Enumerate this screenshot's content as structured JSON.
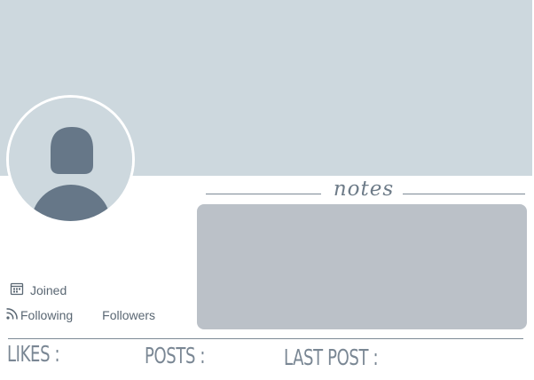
{
  "profile": {
    "joined_label": "Joined",
    "following_label": "Following",
    "followers_label": "Followers"
  },
  "notes": {
    "heading": "notes"
  },
  "footer": {
    "likes_label": "LIKES :",
    "posts_label": "POSTS :",
    "last_post_label": "LAST POST :"
  },
  "icons": {
    "avatar": "user-silhouette-icon",
    "joined": "calendar-icon",
    "following": "rss-icon"
  },
  "colors": {
    "banner": "#cdd8de",
    "avatar_silhouette": "#667788",
    "notes_box": "#bbc1c8",
    "text": "#5a6773"
  }
}
